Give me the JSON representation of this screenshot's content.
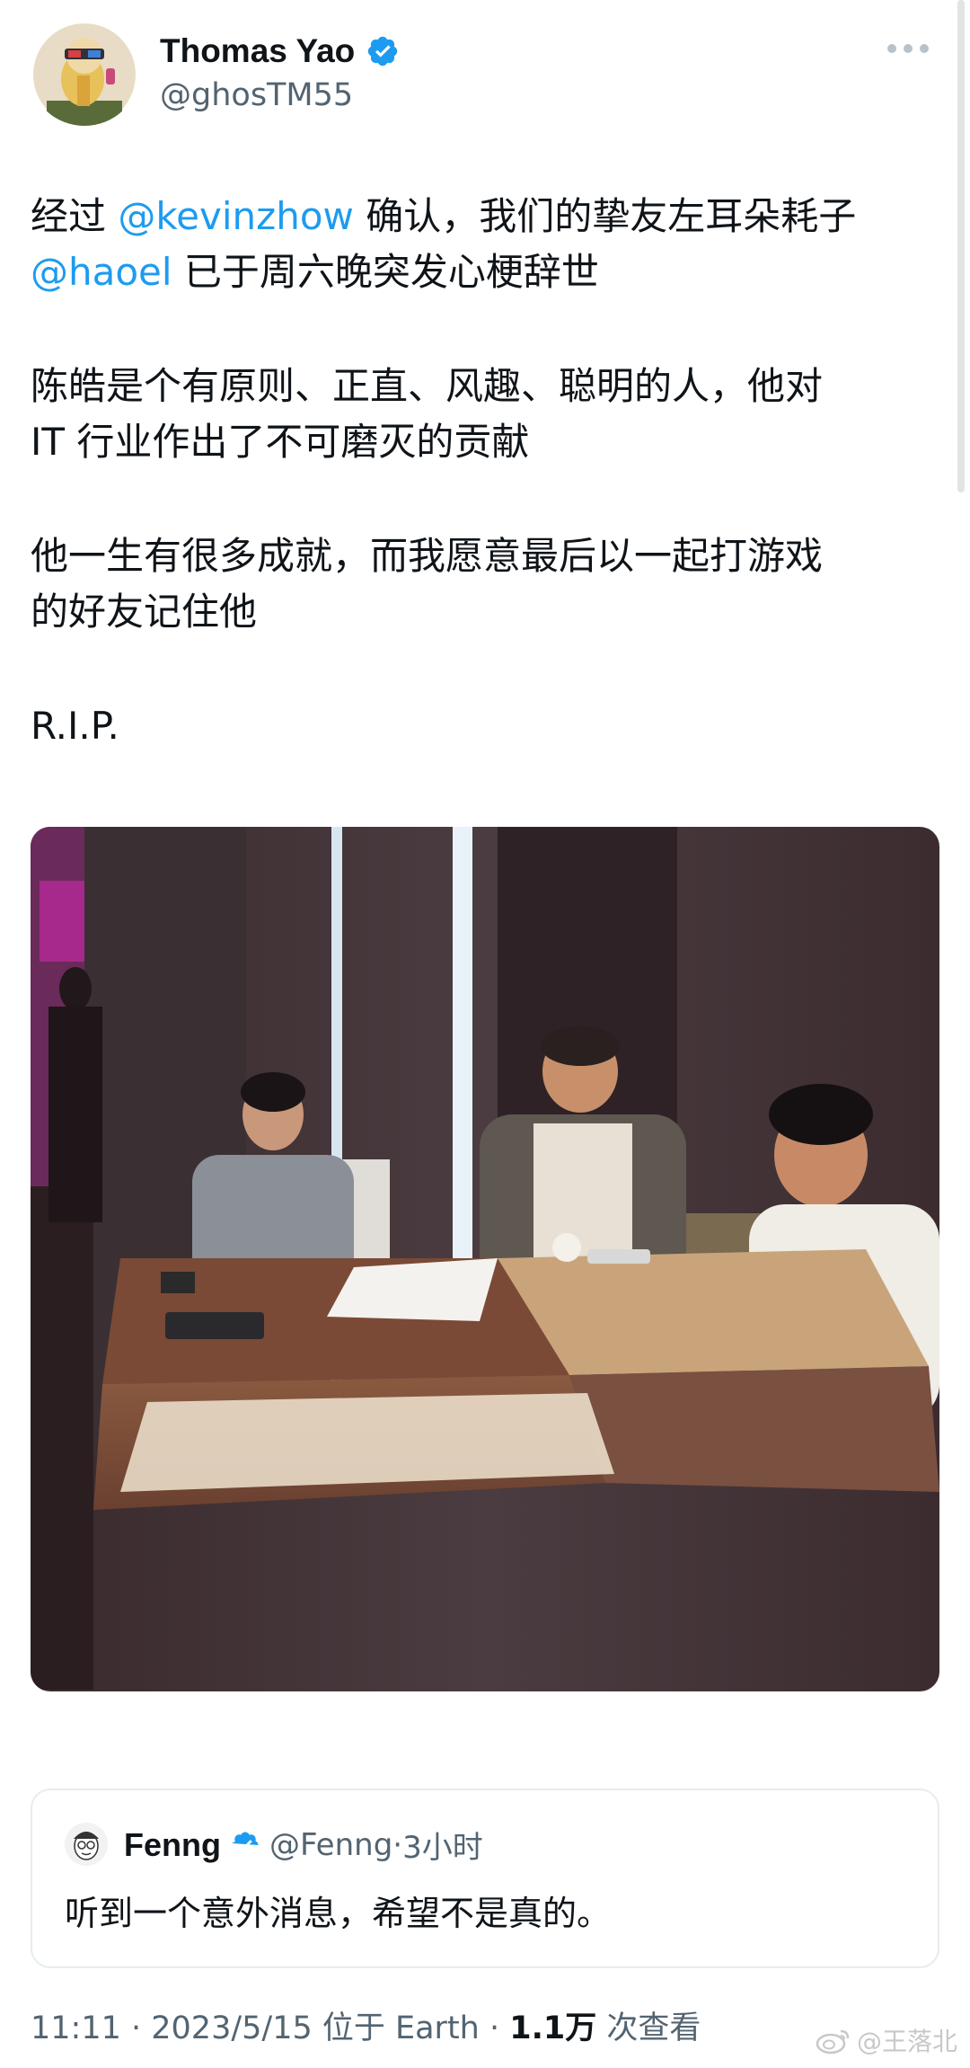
{
  "author": {
    "name": "Thomas Yao",
    "handle": "@ghosTM55",
    "verified": true,
    "avatar_icon": "cartoon-avatar-icon"
  },
  "tweet": {
    "segments": {
      "p1_a": "经过 ",
      "p1_mention1": "@kevinzhow",
      "p1_b": " 确认，我们的挚友左耳朵耗子",
      "p1_mention2": "@haoel",
      "p1_c": " 已于周六晚突发心梗辞世",
      "p2_line1": "陈皓是个有原则、正直、风趣、聪明的人，他对",
      "p2_line2": "IT 行业作出了不可磨灭的贡献",
      "p3_line1": "他一生有很多成就，而我愿意最后以一起打游戏",
      "p3_line2": "的好友记住他",
      "p4": "R.I.P."
    },
    "link_color": "#1d9bf0"
  },
  "quoted_tweet": {
    "name": "Fenng",
    "handle": "@Fenng",
    "separator": "·",
    "time": "3小时",
    "text": "听到一个意外消息，希望不是真的。",
    "verified": true
  },
  "footer": {
    "time": "11:11",
    "sep1": " · ",
    "date": "2023/5/15",
    "location_prefix": " 位于 ",
    "location": "Earth",
    "sep2": " · ",
    "views": "1.1万",
    "views_label": " 次查看"
  },
  "watermark": {
    "text": "@王落北"
  },
  "colors": {
    "verified_blue": "#1d9bf0",
    "secondary_text": "#536471"
  }
}
